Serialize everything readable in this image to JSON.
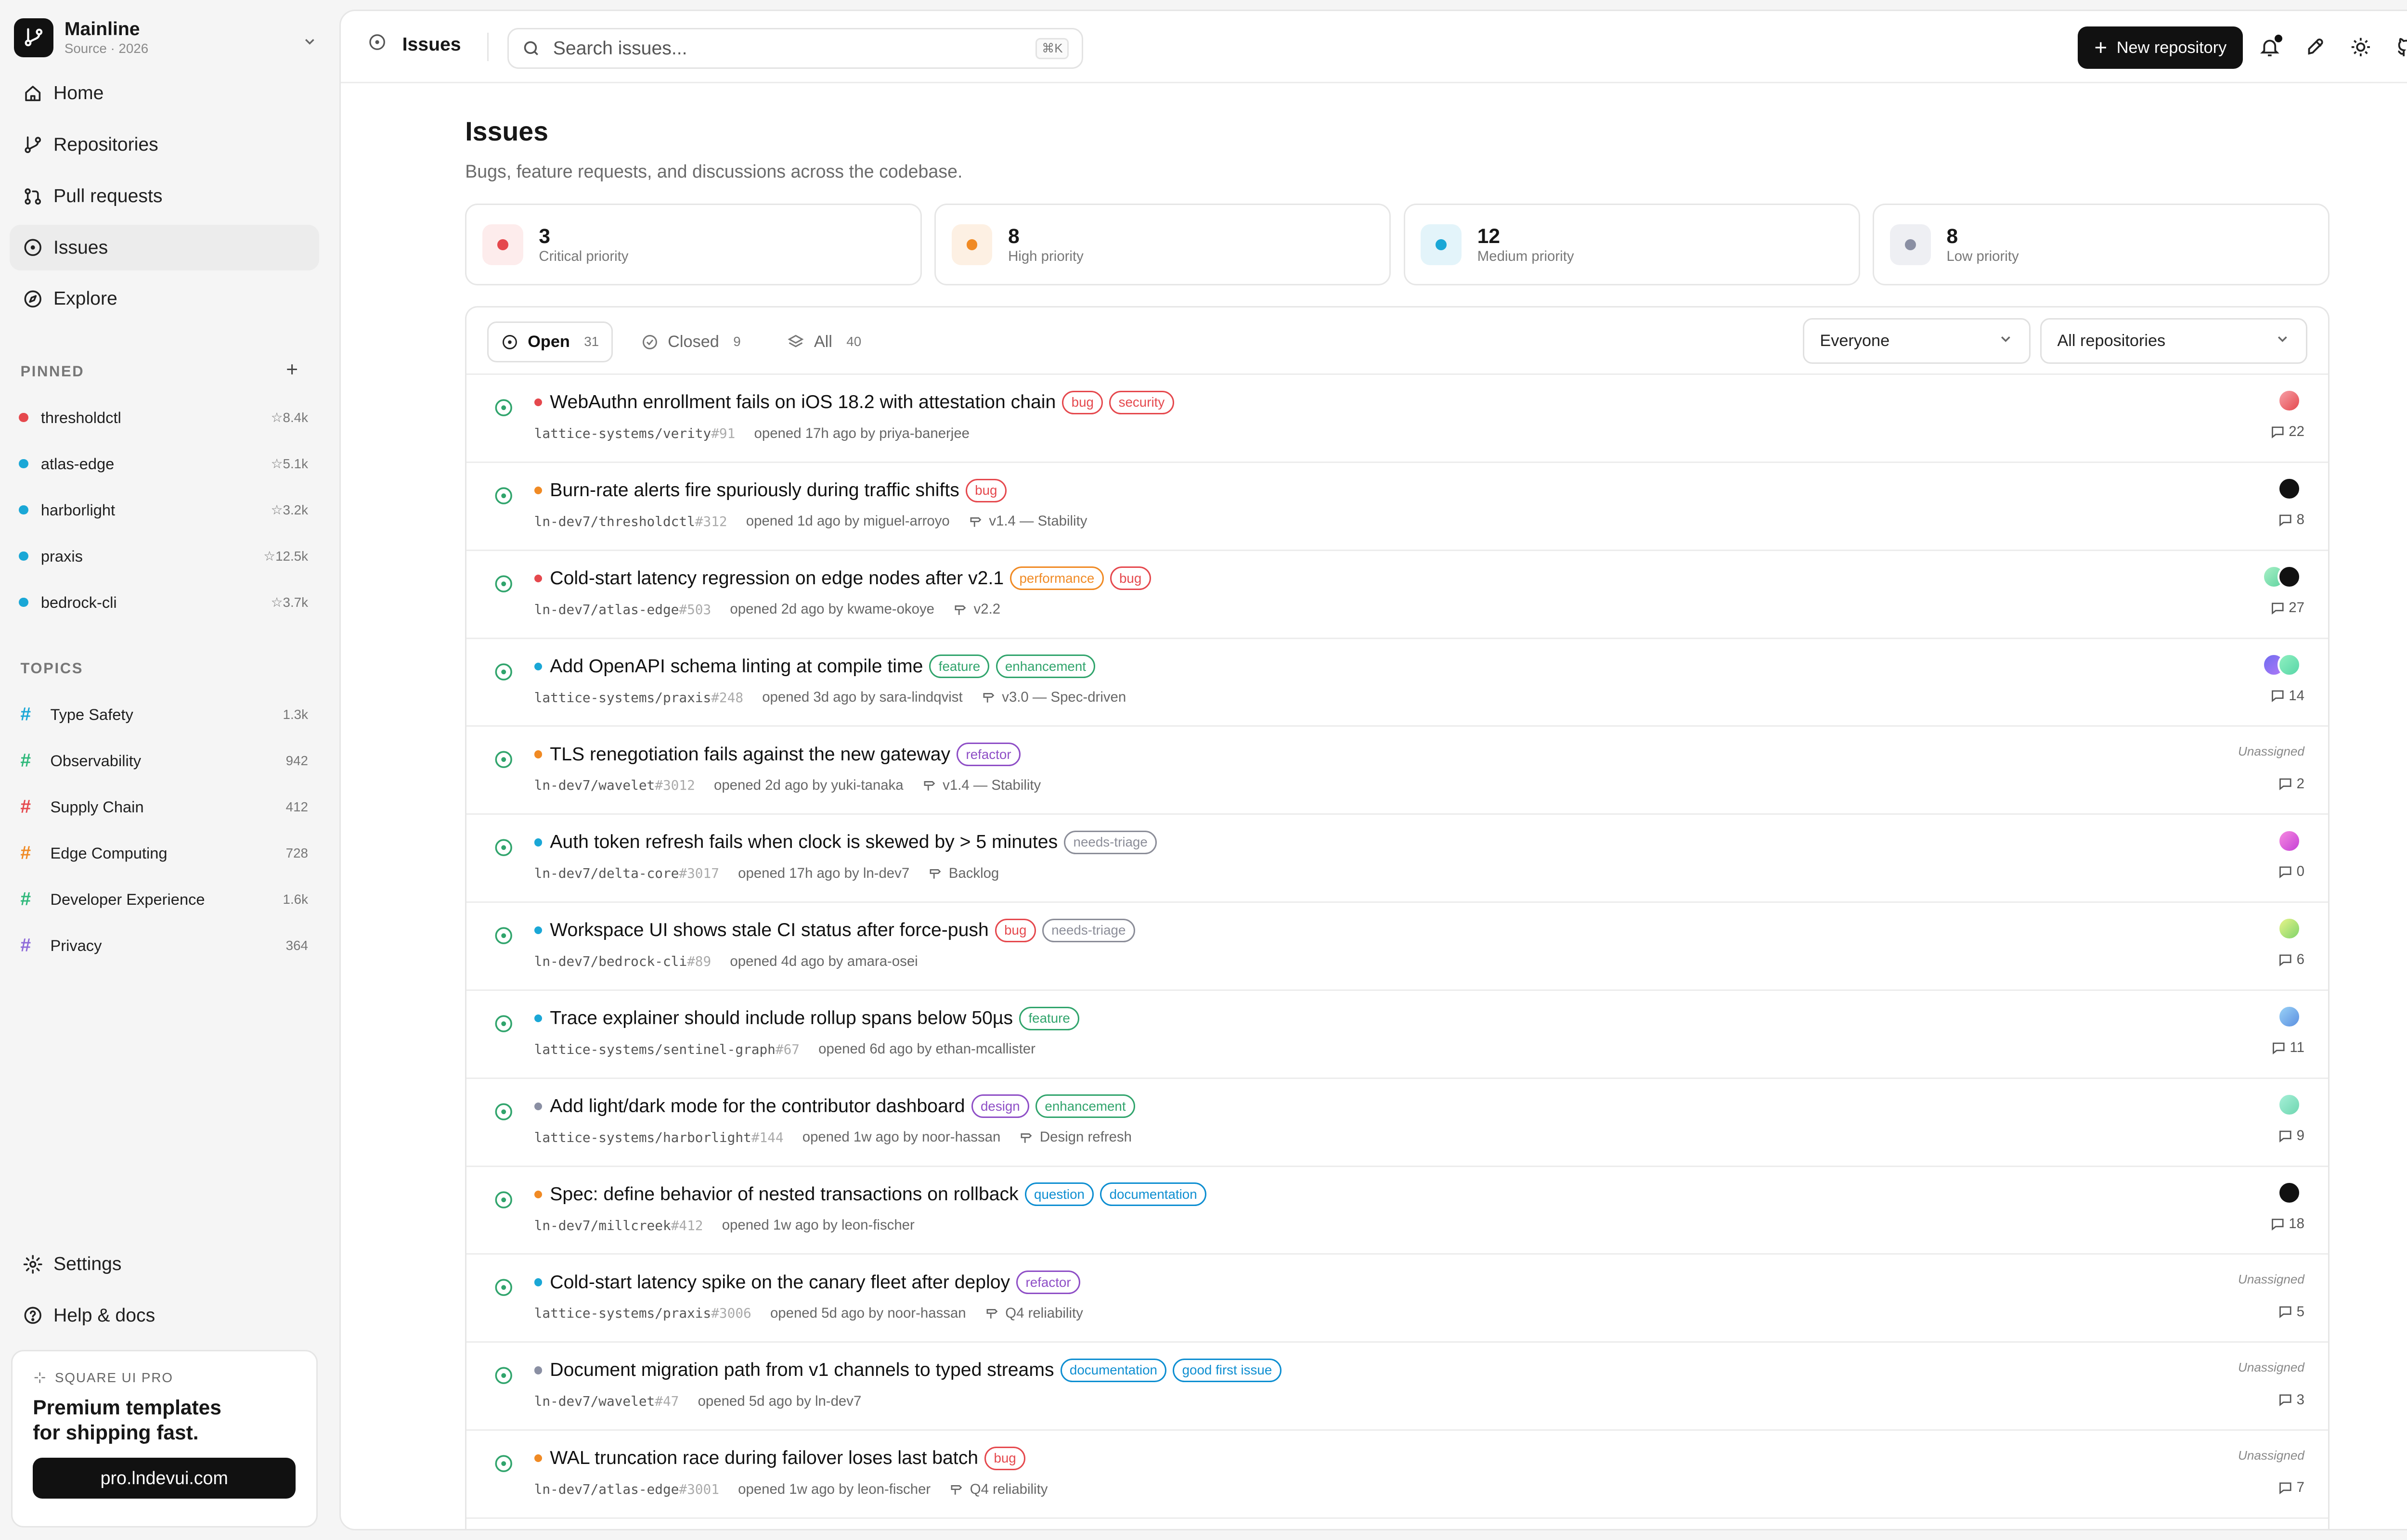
{
  "brand": {
    "name": "Mainline",
    "sub": "Source · 2026"
  },
  "nav": [
    {
      "label": "Home",
      "icon": "home-icon"
    },
    {
      "label": "Repositories",
      "icon": "branch-icon"
    },
    {
      "label": "Pull requests",
      "icon": "pull-request-icon"
    },
    {
      "label": "Issues",
      "icon": "issue-icon",
      "active": true
    },
    {
      "label": "Explore",
      "icon": "compass-icon"
    }
  ],
  "pinned": {
    "title": "PINNED",
    "items": [
      {
        "name": "thresholdctl",
        "stars": "8.4k",
        "color": "#e5484d"
      },
      {
        "name": "atlas-edge",
        "stars": "5.1k",
        "color": "#1aa7d6"
      },
      {
        "name": "harborlight",
        "stars": "3.2k",
        "color": "#1aa7d6"
      },
      {
        "name": "praxis",
        "stars": "12.5k",
        "color": "#1aa7d6"
      },
      {
        "name": "bedrock-cli",
        "stars": "3.7k",
        "color": "#1aa7d6"
      }
    ]
  },
  "topics": {
    "title": "TOPICS",
    "items": [
      {
        "name": "Type Safety",
        "count": "1.3k",
        "color": "#1aa7d6"
      },
      {
        "name": "Observability",
        "count": "942",
        "color": "#2eb87a"
      },
      {
        "name": "Supply Chain",
        "count": "412",
        "color": "#e5484d"
      },
      {
        "name": "Edge Computing",
        "count": "728",
        "color": "#f08a24"
      },
      {
        "name": "Developer Experience",
        "count": "1.6k",
        "color": "#2eb87a"
      },
      {
        "name": "Privacy",
        "count": "364",
        "color": "#8e6bd9"
      }
    ]
  },
  "bottom_nav": [
    {
      "label": "Settings",
      "icon": "gear-icon"
    },
    {
      "label": "Help & docs",
      "icon": "help-icon"
    }
  ],
  "promo": {
    "tag": "SQUARE UI PRO",
    "title_line1": "Premium templates",
    "title_line2": "for shipping fast.",
    "button": "pro.lndevui.com"
  },
  "topbar": {
    "crumb": "Issues",
    "search_placeholder": "Search issues...",
    "kbd": "⌘K",
    "new_repo": "New repository"
  },
  "page": {
    "title": "Issues",
    "subtitle": "Bugs, feature requests, and discussions across the codebase."
  },
  "stats": [
    {
      "value": "3",
      "label": "Critical priority",
      "color": "#e5484d",
      "bg": "#fdecec"
    },
    {
      "value": "8",
      "label": "High priority",
      "color": "#f08a24",
      "bg": "#fdf0e3"
    },
    {
      "value": "12",
      "label": "Medium priority",
      "color": "#1aa7d6",
      "bg": "#e3f4fa"
    },
    {
      "value": "8",
      "label": "Low priority",
      "color": "#8a8fa3",
      "bg": "#eeeff3"
    }
  ],
  "filters": {
    "tabs": [
      {
        "label": "Open",
        "count": "31",
        "active": true
      },
      {
        "label": "Closed",
        "count": "9"
      },
      {
        "label": "All",
        "count": "40"
      }
    ],
    "assignee": "Everyone",
    "repository": "All repositories"
  },
  "label_colors": {
    "bug": "#e5484d",
    "security": "#e5484d",
    "performance": "#f08a24",
    "feature": "#30a46c",
    "enhancement": "#30a46c",
    "refactor": "#8e4ec6",
    "needs-triage": "#8b8d98",
    "design": "#8e4ec6",
    "question": "#0d8ed1",
    "documentation": "#0d8ed1",
    "good first issue": "#0d8ed1"
  },
  "issues": [
    {
      "title": "WebAuthn enrollment fails on iOS 18.2 with attestation chain",
      "priority": "#e5484d",
      "labels": [
        "bug",
        "security"
      ],
      "repo": "lattice-systems/verity",
      "number": "#91",
      "opened": "opened 17h ago by priya-banerjee",
      "milestone": "",
      "assignees": [
        "linear-gradient(135deg,#f7a1a8,#e5484d)"
      ],
      "comments": "22"
    },
    {
      "title": "Burn-rate alerts fire spuriously during traffic shifts",
      "priority": "#f08a24",
      "labels": [
        "bug"
      ],
      "repo": "ln-dev7/thresholdctl",
      "number": "#312",
      "opened": "opened 1d ago by miguel-arroyo",
      "milestone": "v1.4 — Stability",
      "assignees": [
        "#111111"
      ],
      "comments": "8"
    },
    {
      "title": "Cold-start latency regression on edge nodes after v2.1",
      "priority": "#e5484d",
      "labels": [
        "performance",
        "bug"
      ],
      "repo": "ln-dev7/atlas-edge",
      "number": "#503",
      "opened": "opened 2d ago by kwame-okoye",
      "milestone": "v2.2",
      "assignees": [
        "linear-gradient(135deg,#a8f0c6,#5fd3a0)",
        "#111111"
      ],
      "comments": "27"
    },
    {
      "title": "Add OpenAPI schema linting at compile time",
      "priority": "#1aa7d6",
      "labels": [
        "feature",
        "enhancement"
      ],
      "repo": "lattice-systems/praxis",
      "number": "#248",
      "opened": "opened 3d ago by sara-lindqvist",
      "milestone": "v3.0 — Spec-driven",
      "assignees": [
        "linear-gradient(135deg,#6f6cf0,#b07af7)",
        "linear-gradient(135deg,#8ff0c0,#58d6a8)"
      ],
      "comments": "14"
    },
    {
      "title": "TLS renegotiation fails against the new gateway",
      "priority": "#f08a24",
      "labels": [
        "refactor"
      ],
      "repo": "ln-dev7/wavelet",
      "number": "#3012",
      "opened": "opened 2d ago by yuki-tanaka",
      "milestone": "v1.4 — Stability",
      "assignees": [],
      "unassigned": "Unassigned",
      "comments": "2"
    },
    {
      "title": "Auth token refresh fails when clock is skewed by > 5 minutes",
      "priority": "#1aa7d6",
      "labels": [
        "needs-triage"
      ],
      "repo": "ln-dev7/delta-core",
      "number": "#3017",
      "opened": "opened 17h ago by ln-dev7",
      "milestone": "Backlog",
      "assignees": [
        "linear-gradient(135deg,#f78be0,#c53fd6)"
      ],
      "comments": "0"
    },
    {
      "title": "Workspace UI shows stale CI status after force-push",
      "priority": "#1aa7d6",
      "labels": [
        "bug",
        "needs-triage"
      ],
      "repo": "ln-dev7/bedrock-cli",
      "number": "#89",
      "opened": "opened 4d ago by amara-osei",
      "milestone": "",
      "assignees": [
        "linear-gradient(135deg,#e8f58a,#7fd36a)"
      ],
      "comments": "6"
    },
    {
      "title": "Trace explainer should include rollup spans below 50µs",
      "priority": "#1aa7d6",
      "labels": [
        "feature"
      ],
      "repo": "lattice-systems/sentinel-graph",
      "number": "#67",
      "opened": "opened 6d ago by ethan-mcallister",
      "milestone": "",
      "assignees": [
        "linear-gradient(135deg,#9ad2f7,#5b8fe0)"
      ],
      "comments": "11"
    },
    {
      "title": "Add light/dark mode for the contributor dashboard",
      "priority": "#8a8fa3",
      "labels": [
        "design",
        "enhancement"
      ],
      "repo": "lattice-systems/harborlight",
      "number": "#144",
      "opened": "opened 1w ago by noor-hassan",
      "milestone": "Design refresh",
      "assignees": [
        "linear-gradient(135deg,#a6f0d8,#6fd6b0)"
      ],
      "comments": "9"
    },
    {
      "title": "Spec: define behavior of nested transactions on rollback",
      "priority": "#f08a24",
      "labels": [
        "question",
        "documentation"
      ],
      "repo": "ln-dev7/millcreek",
      "number": "#412",
      "opened": "opened 1w ago by leon-fischer",
      "milestone": "",
      "assignees": [
        "#111111"
      ],
      "comments": "18"
    },
    {
      "title": "Cold-start latency spike on the canary fleet after deploy",
      "priority": "#1aa7d6",
      "labels": [
        "refactor"
      ],
      "repo": "lattice-systems/praxis",
      "number": "#3006",
      "opened": "opened 5d ago by noor-hassan",
      "milestone": "Q4 reliability",
      "assignees": [],
      "unassigned": "Unassigned",
      "comments": "5"
    },
    {
      "title": "Document migration path from v1 channels to typed streams",
      "priority": "#8a8fa3",
      "labels": [
        "documentation",
        "good first issue"
      ],
      "repo": "ln-dev7/wavelet",
      "number": "#47",
      "opened": "opened 5d ago by ln-dev7",
      "milestone": "",
      "assignees": [],
      "unassigned": "Unassigned",
      "comments": "3"
    },
    {
      "title": "WAL truncation race during failover loses last batch",
      "priority": "#f08a24",
      "labels": [
        "bug"
      ],
      "repo": "ln-dev7/atlas-edge",
      "number": "#3001",
      "opened": "opened 1w ago by leon-fischer",
      "milestone": "Q4 reliability",
      "assignees": [],
      "unassigned": "Unassigned",
      "comments": "7"
    }
  ]
}
